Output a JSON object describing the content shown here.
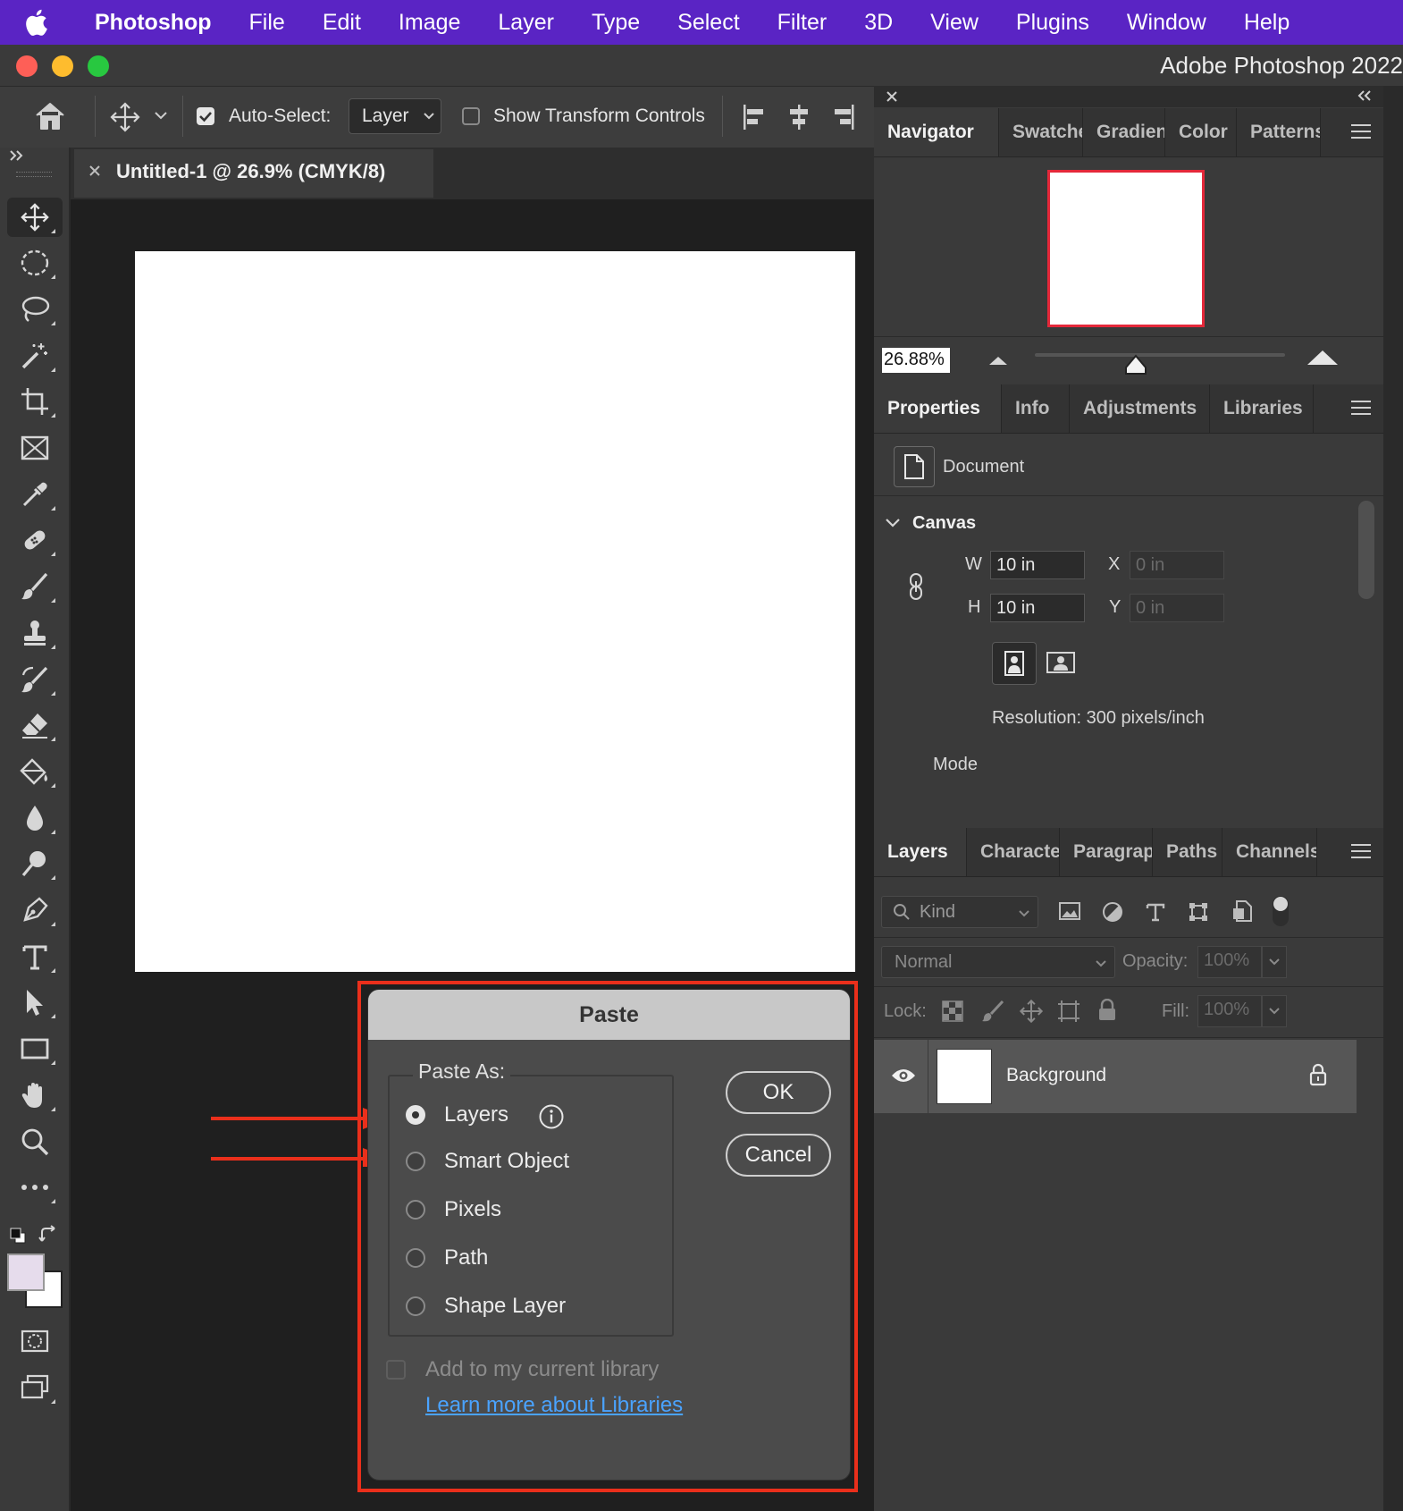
{
  "menubar": {
    "app": "Photoshop",
    "items": [
      "File",
      "Edit",
      "Image",
      "Layer",
      "Type",
      "Select",
      "Filter",
      "3D",
      "View",
      "Plugins",
      "Window",
      "Help"
    ]
  },
  "window": {
    "title": "Adobe Photoshop 2022"
  },
  "options_bar": {
    "auto_select_label": "Auto-Select:",
    "auto_select_value": "Layer",
    "show_transform_label": "Show Transform Controls"
  },
  "document": {
    "tab_title": "Untitled-1 @ 26.9% (CMYK/8)"
  },
  "navigator": {
    "tabs": [
      "Navigator",
      "Swatches",
      "Gradients",
      "Color",
      "Patterns"
    ],
    "zoom": "26.88%"
  },
  "properties": {
    "tabs": [
      "Properties",
      "Info",
      "Adjustments",
      "Libraries"
    ],
    "section": "Document",
    "canvas_label": "Canvas",
    "w_label": "W",
    "w_value": "10 in",
    "h_label": "H",
    "h_value": "10 in",
    "x_label": "X",
    "x_value": "0 in",
    "y_label": "Y",
    "y_value": "0 in",
    "resolution": "Resolution: 300 pixels/inch",
    "mode_label": "Mode"
  },
  "layers_panel": {
    "tabs": [
      "Layers",
      "Character",
      "Paragraph",
      "Paths",
      "Channels"
    ],
    "filter_kind": "Kind",
    "blend_mode": "Normal",
    "opacity_label": "Opacity:",
    "opacity_value": "100%",
    "lock_label": "Lock:",
    "fill_label": "Fill:",
    "fill_value": "100%",
    "layers": [
      {
        "name": "Background"
      }
    ]
  },
  "paste_dialog": {
    "title": "Paste",
    "group_label": "Paste As:",
    "options": [
      "Layers",
      "Smart Object",
      "Pixels",
      "Path",
      "Shape Layer"
    ],
    "selected": "Layers",
    "ok_label": "OK",
    "cancel_label": "Cancel",
    "library_checkbox_label": "Add to my current library",
    "learn_more_link": "Learn more about Libraries"
  },
  "colors": {
    "menubar_bg": "#5a24c4",
    "annotation_red": "#ea2f1b",
    "link_blue": "#4aa3ff",
    "foreground_swatch": "#e6dcec",
    "background_swatch": "#ffffff"
  }
}
